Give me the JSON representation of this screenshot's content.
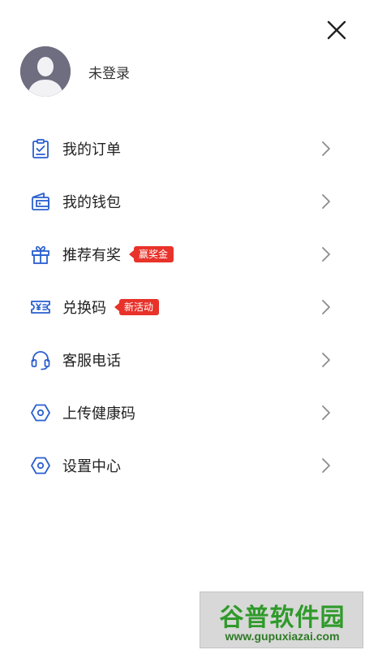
{
  "drawer": {
    "close_icon": "close-icon",
    "profile": {
      "avatar_icon": "default-avatar-icon",
      "status_text": "未登录"
    },
    "menu": [
      {
        "id": "orders",
        "icon": "clipboard-check-icon",
        "label": "我的订单"
      },
      {
        "id": "wallet",
        "icon": "wallet-icon",
        "label": "我的钱包"
      },
      {
        "id": "referral",
        "icon": "gift-icon",
        "label": "推荐有奖",
        "badge": "赢奖金"
      },
      {
        "id": "redeem",
        "icon": "yen-ticket-icon",
        "label": "兑换码",
        "badge": "新活动"
      },
      {
        "id": "service",
        "icon": "headset-icon",
        "label": "客服电话"
      },
      {
        "id": "health",
        "icon": "hexagon-icon",
        "label": "上传健康码"
      },
      {
        "id": "settings",
        "icon": "hexagon-icon",
        "label": "设置中心"
      }
    ],
    "colors": {
      "accent": "#2a5fd0",
      "badge": "#e8322a",
      "chevron": "#8c8c8c"
    }
  },
  "watermark": {
    "title": "谷普软件园",
    "url": "www.gupuxiazai.com"
  }
}
